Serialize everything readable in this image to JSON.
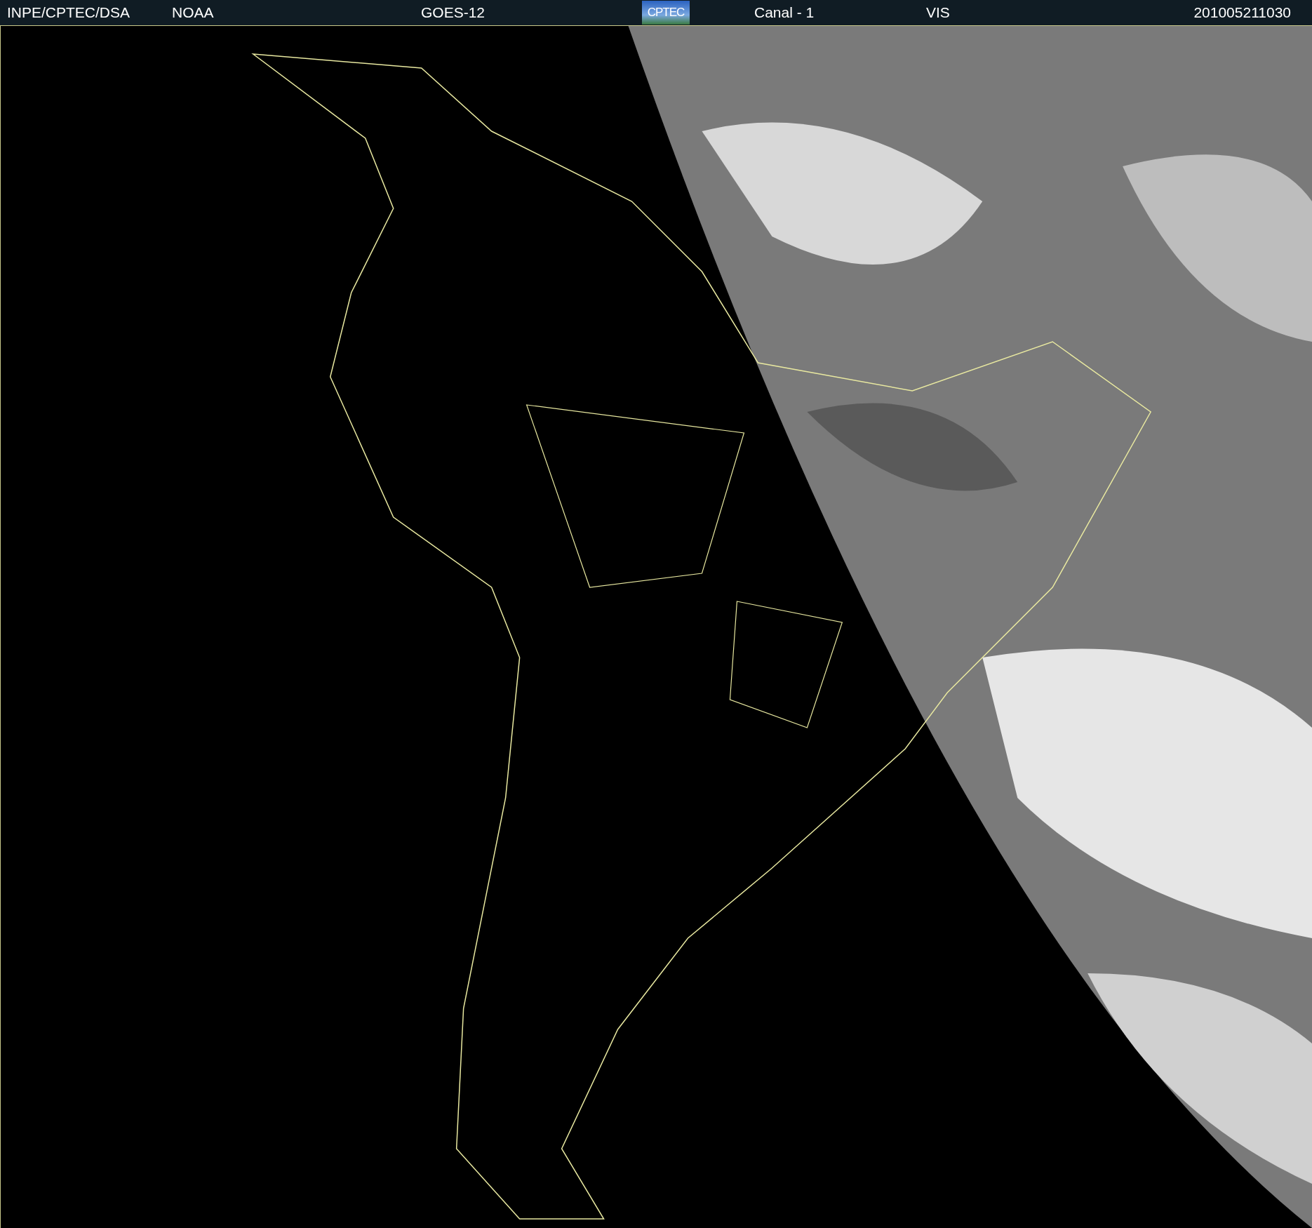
{
  "header": {
    "source": "INPE/CPTEC/DSA",
    "agency": "NOAA",
    "satellite": "GOES-12",
    "logo": "CPTEC",
    "channel": "Canal - 1",
    "band": "VIS",
    "timestamp": "201005211030"
  }
}
